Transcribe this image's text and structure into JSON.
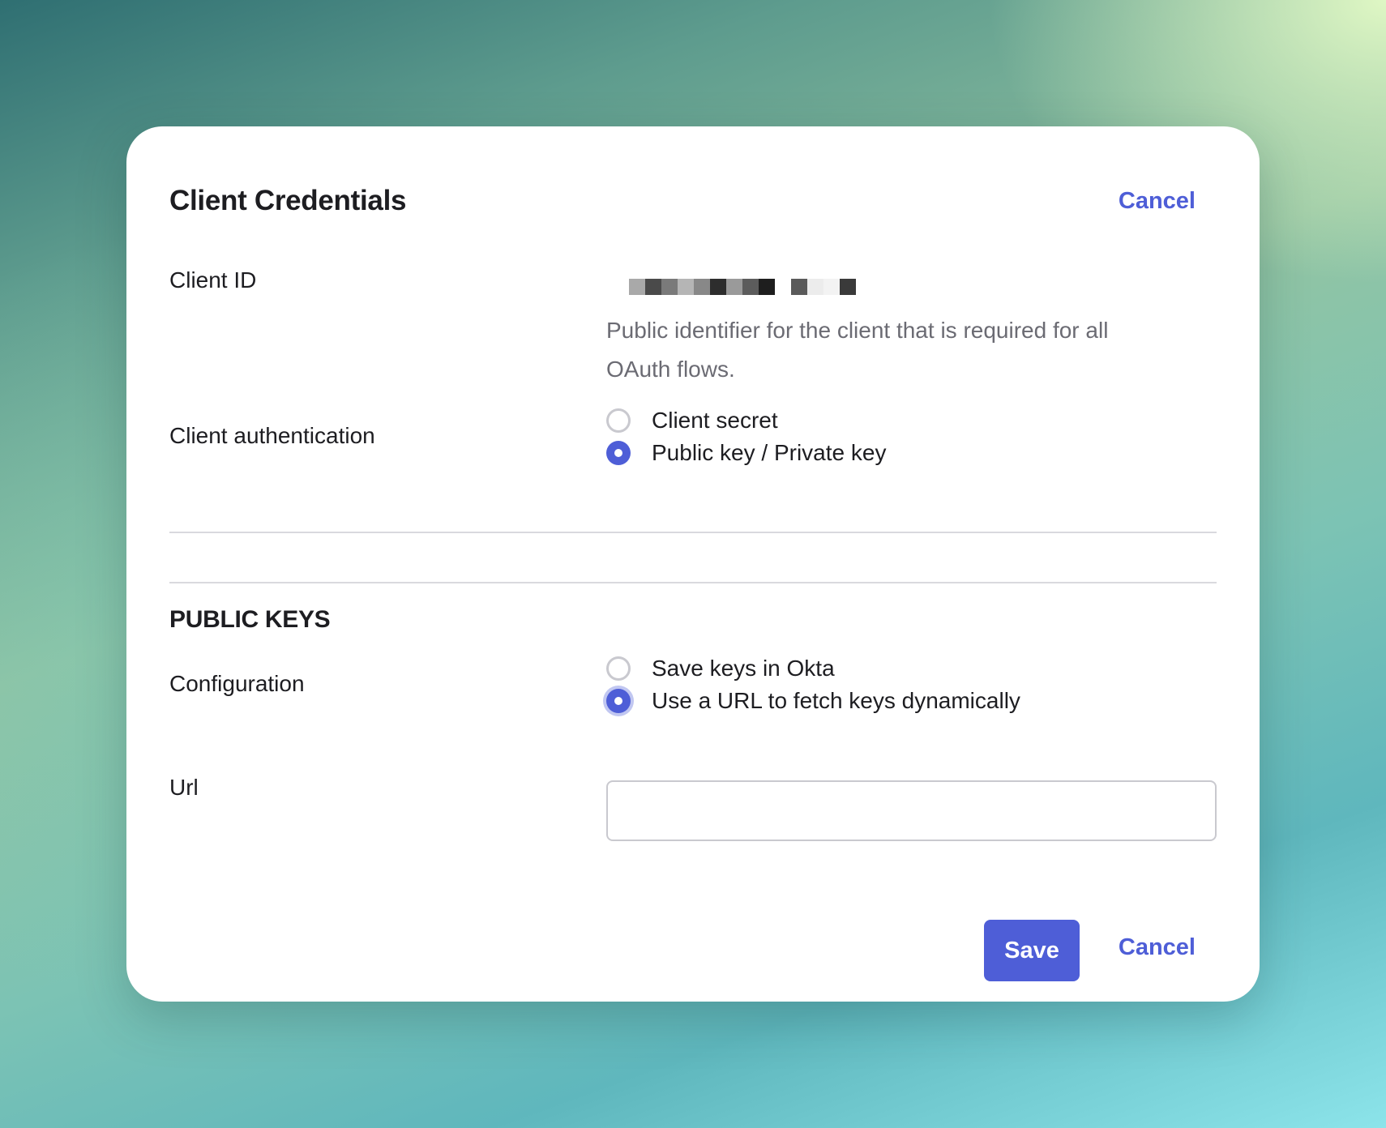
{
  "dialog": {
    "title": "Client Credentials",
    "cancel_top_label": "Cancel"
  },
  "client_id": {
    "label": "Client ID",
    "value_redacted": true,
    "help_text": "Public identifier for the client that is required for all OAuth flows."
  },
  "client_authentication": {
    "label": "Client authentication",
    "options": [
      {
        "label": "Client secret",
        "checked": false
      },
      {
        "label": "Public key / Private key",
        "checked": true
      }
    ]
  },
  "public_keys": {
    "section_title": "PUBLIC KEYS",
    "configuration": {
      "label": "Configuration",
      "options": [
        {
          "label": "Save keys in Okta",
          "checked": false
        },
        {
          "label": "Use a URL to fetch keys dynamically",
          "checked": true
        }
      ]
    },
    "url": {
      "label": "Url",
      "value": "",
      "placeholder": ""
    }
  },
  "footer": {
    "save_label": "Save",
    "cancel_label": "Cancel"
  },
  "colors": {
    "accent": "#4e5ed7",
    "text": "#1d1d21",
    "muted_text": "#6b6b73"
  }
}
